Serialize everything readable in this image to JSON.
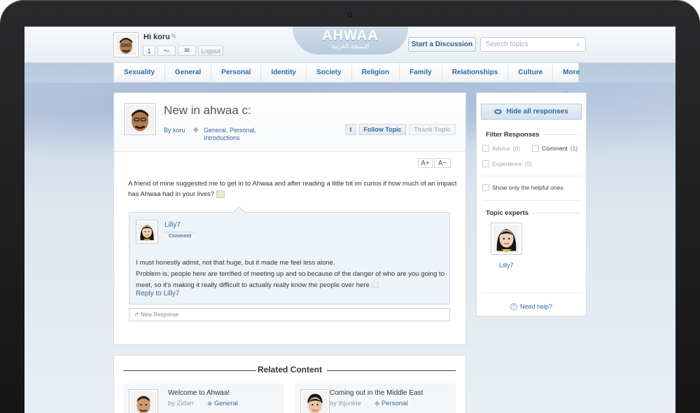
{
  "header": {
    "greeting": "Hi koru",
    "notif_count": "1",
    "logout": "Logout",
    "logo": "AHWAA",
    "logo_arabic": "النسخة العربية",
    "start_discussion": "Start a Discussion",
    "search_placeholder": "Search topics"
  },
  "nav": [
    "Sexuality",
    "General",
    "Personal",
    "Identity",
    "Society",
    "Religion",
    "Family",
    "Relationships",
    "Culture",
    "More ⌄"
  ],
  "post": {
    "title": "New in ahwaa c:",
    "by": "By koru",
    "tags": "General, Personal, Introductions",
    "twitter": "t",
    "follow": "Follow Topic",
    "thank": "Thank Topic",
    "font_up": "A+",
    "font_down": "A−",
    "body": "A friend of mine suggested me to get in to Ahwaa and after reading a little bit im curios if how much of an impact has Ahwaa had in your lives?"
  },
  "response": {
    "author": "Lilly7",
    "badge": "Comment",
    "line1": "I must honestly admit, not that huge, but it made me feel less alone.",
    "line2": "Problem is, people here are terrified of meeting up and so because of the danger of who are you going to meet, so it's making it really difficult to actually really know the people over here",
    "reply": "Reply to Lilly7",
    "new_response": "New Response"
  },
  "sidebar": {
    "hide_all": "Hide all responses",
    "filter_title": "Filter Responses",
    "advice": "Advice",
    "advice_count": "(0)",
    "comment": "Comment",
    "comment_count": "(1)",
    "experience": "Experience",
    "experience_count": "(0)",
    "helpful": "Show only the helpful ones",
    "experts_title": "Topic experts",
    "expert_name": "Lilly7",
    "help": "Need help?"
  },
  "related": {
    "title": "Related Content",
    "items": [
      {
        "title": "Welcome to Ahwaa!",
        "by": "by Zidan",
        "tag": "General"
      },
      {
        "title": "Coming out in the Middle East",
        "by": "by lhjunkie",
        "tag": "Personal"
      }
    ]
  },
  "colors": {
    "link": "#2f6aa1",
    "accent_bg": "#eef3f9"
  }
}
